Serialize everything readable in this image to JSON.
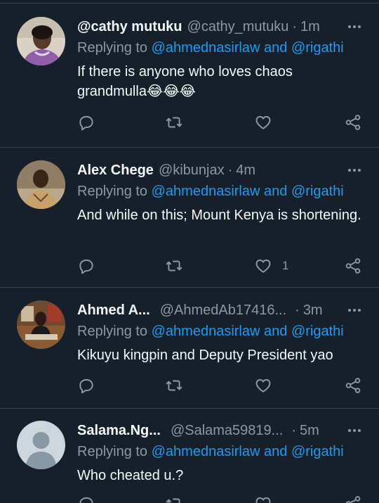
{
  "colors": {
    "background": "#15202b",
    "accent": "#1d9bf0",
    "muted": "#8b98a5",
    "divider": "#38444d"
  },
  "tweets": [
    {
      "name": "@cathy mutuku",
      "handle": "@cathy_mutuku",
      "time": "1m",
      "reply_prefix": "Replying to ",
      "mention1": "@ahmednasirlaw",
      "reply_and": " and ",
      "mention2": "@rigathi",
      "text": "If there is anyone who loves chaos grandmulla😂😂😂",
      "likes": ""
    },
    {
      "name": "Alex Chege",
      "handle": "@kibunjax",
      "time": "4m",
      "reply_prefix": "Replying to ",
      "mention1": "@ahmednasirlaw",
      "reply_and": " and ",
      "mention2": "@rigathi",
      "text": "And while on this; Mount Kenya is shortening.",
      "likes": "1"
    },
    {
      "name": "Ahmed A...",
      "handle": "@AhmedAb17416...",
      "time": "3m",
      "reply_prefix": "Replying to ",
      "mention1": "@ahmednasirlaw",
      "reply_and": " and ",
      "mention2": "@rigathi",
      "text": "Kikuyu kingpin and Deputy President yao",
      "likes": ""
    },
    {
      "name": "Salama.Ng...",
      "handle": "@Salama59819...",
      "time": "5m",
      "reply_prefix": "Replying to ",
      "mention1": "@ahmednasirlaw",
      "reply_and": " and ",
      "mention2": "@rigathi",
      "text": "Who cheated u.?",
      "likes": ""
    }
  ],
  "icons": {
    "reply": "reply-icon",
    "retweet": "retweet-icon",
    "like": "like-icon",
    "share": "share-icon",
    "more": "more-icon"
  },
  "separator": "·"
}
